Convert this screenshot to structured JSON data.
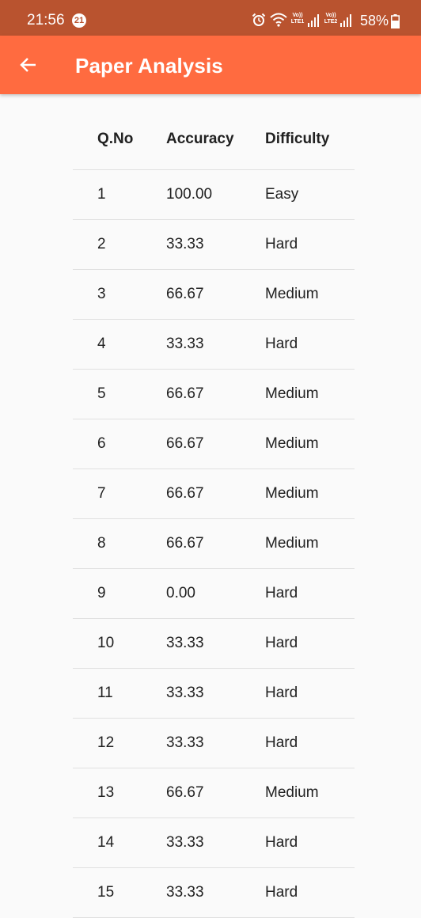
{
  "status_bar": {
    "time": "21:56",
    "notification_count": "21",
    "lte1": "Vo)) LTE1",
    "lte2": "Vo)) LTE2",
    "battery": "58%"
  },
  "app_bar": {
    "title": "Paper Analysis",
    "back_icon": "arrow-left-icon"
  },
  "colors": {
    "status_bar_bg": "#b9532f",
    "app_bar_bg": "#ff6b40",
    "page_bg": "#fafafa",
    "divider": "#e0e0e0"
  },
  "table": {
    "headers": {
      "qno": "Q.No",
      "accuracy": "Accuracy",
      "difficulty": "Difficulty"
    },
    "rows": [
      {
        "qno": "1",
        "accuracy": "100.00",
        "difficulty": "Easy"
      },
      {
        "qno": "2",
        "accuracy": "33.33",
        "difficulty": "Hard"
      },
      {
        "qno": "3",
        "accuracy": "66.67",
        "difficulty": "Medium"
      },
      {
        "qno": "4",
        "accuracy": "33.33",
        "difficulty": "Hard"
      },
      {
        "qno": "5",
        "accuracy": "66.67",
        "difficulty": "Medium"
      },
      {
        "qno": "6",
        "accuracy": "66.67",
        "difficulty": "Medium"
      },
      {
        "qno": "7",
        "accuracy": "66.67",
        "difficulty": "Medium"
      },
      {
        "qno": "8",
        "accuracy": "66.67",
        "difficulty": "Medium"
      },
      {
        "qno": "9",
        "accuracy": "0.00",
        "difficulty": "Hard"
      },
      {
        "qno": "10",
        "accuracy": "33.33",
        "difficulty": "Hard"
      },
      {
        "qno": "11",
        "accuracy": "33.33",
        "difficulty": "Hard"
      },
      {
        "qno": "12",
        "accuracy": "33.33",
        "difficulty": "Hard"
      },
      {
        "qno": "13",
        "accuracy": "66.67",
        "difficulty": "Medium"
      },
      {
        "qno": "14",
        "accuracy": "33.33",
        "difficulty": "Hard"
      },
      {
        "qno": "15",
        "accuracy": "33.33",
        "difficulty": "Hard"
      }
    ]
  }
}
